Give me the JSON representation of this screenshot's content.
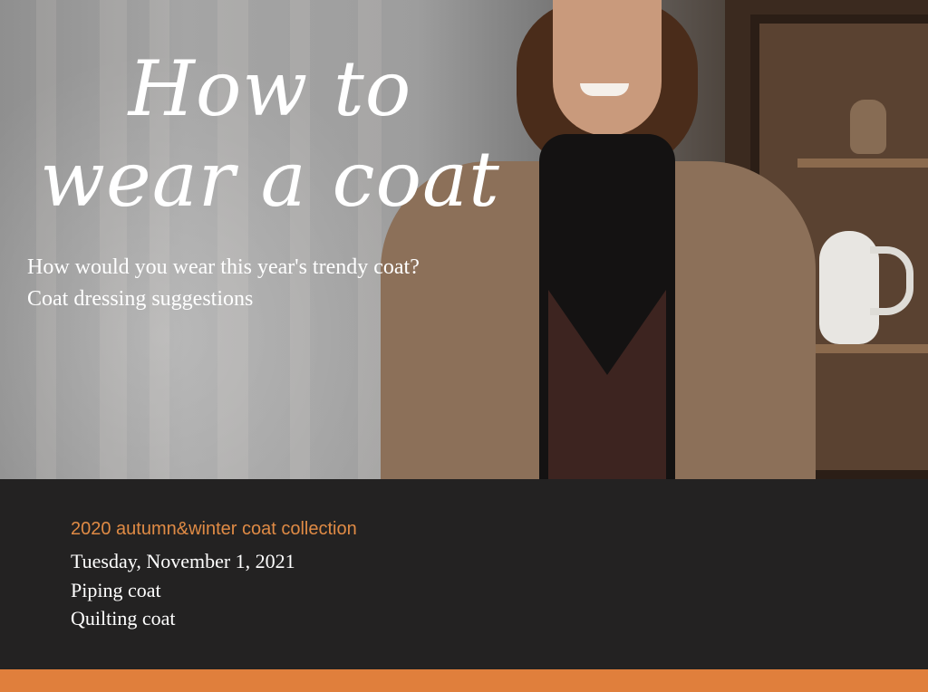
{
  "hero": {
    "title": "How to wear a coat",
    "subtitle": "How would you wear this year's trendy coat?Coat dressing suggestions"
  },
  "info": {
    "collection": "2020 autumn&winter coat collection",
    "date": "Tuesday, November 1, 2021",
    "items": [
      "Piping coat",
      "Quilting coat"
    ]
  },
  "colors": {
    "accent": "#e07f3c",
    "collection_text": "#e08b45",
    "band_background": "#232222"
  }
}
